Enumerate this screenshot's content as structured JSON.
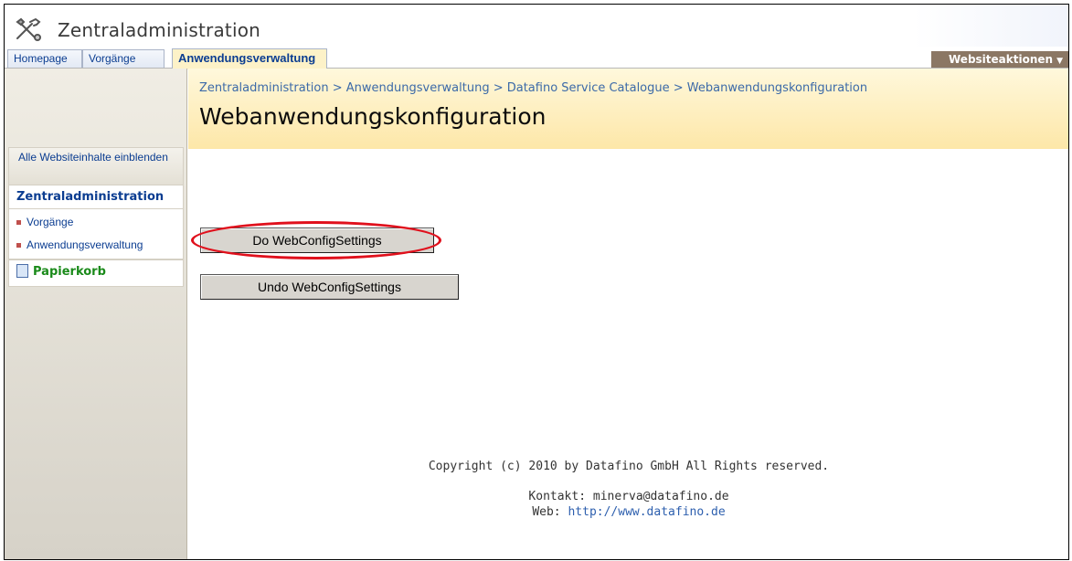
{
  "app": {
    "title": "Zentraladministration"
  },
  "tabs": [
    {
      "label": "Homepage"
    },
    {
      "label": "Vorgänge"
    },
    {
      "label": "Anwendungsverwaltung",
      "active": true
    }
  ],
  "site_actions": {
    "label": "Websiteaktionen",
    "arrow": "▼"
  },
  "breadcrumb": "Zentraladministration > Anwendungsverwaltung > Datafino Service Catalogue > Webanwendungskonfiguration",
  "page_title": "Webanwendungskonfiguration",
  "sidebar": {
    "all_site_content": "Alle Websiteinhalte einblenden",
    "heading": "Zentraladministration",
    "items": [
      {
        "label": "Vorgänge"
      },
      {
        "label": "Anwendungsverwaltung"
      }
    ],
    "recycle_bin": "Papierkorb"
  },
  "buttons": {
    "do_label": "Do WebConfigSettings",
    "undo_label": "Undo WebConfigSettings"
  },
  "footer": {
    "copyright": "Copyright (c) 2010 by Datafino GmbH All Rights reserved.",
    "contact": "Kontakt: minerva@datafino.de",
    "web_prefix": "Web: ",
    "web_link": "http://www.datafino.de"
  },
  "colors": {
    "accent": "#0b3d91",
    "header_bg": "#fde7a8",
    "highlight_circle": "#e0101c",
    "site_actions_bg": "#8b7764"
  }
}
